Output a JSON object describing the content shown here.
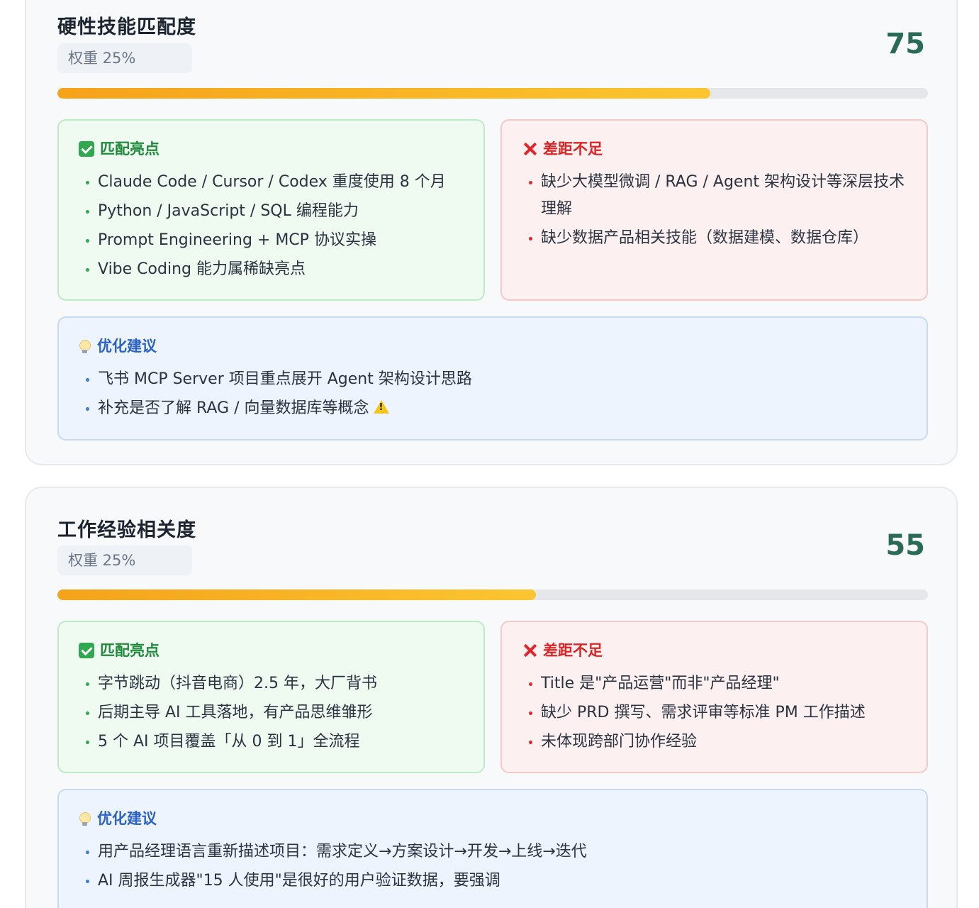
{
  "cards": [
    {
      "title": "硬性技能匹配度",
      "weight": "权重 25%",
      "score": "75",
      "progress_percent": 75,
      "good": {
        "header": "匹配亮点",
        "icon": "check-box-icon",
        "items": [
          "Claude Code / Cursor / Codex 重度使用 8 个月",
          "Python / JavaScript / SQL 编程能力",
          "Prompt Engineering + MCP 协议实操",
          "Vibe Coding 能力属稀缺亮点"
        ]
      },
      "bad": {
        "header": "差距不足",
        "icon": "cross-icon",
        "items": [
          "缺少大模型微调 / RAG / Agent 架构设计等深层技术理解",
          "缺少数据产品相关技能（数据建模、数据仓库）"
        ]
      },
      "tip": {
        "header": "优化建议",
        "icon": "lightbulb-icon",
        "items": [
          "飞书 MCP Server 项目重点展开 Agent 架构设计思路",
          "补充是否了解 RAG / 向量数据库等概念"
        ],
        "warning_icon": "warning-icon"
      }
    },
    {
      "title": "工作经验相关度",
      "weight": "权重 25%",
      "score": "55",
      "progress_percent": 55,
      "good": {
        "header": "匹配亮点",
        "icon": "check-box-icon",
        "items": [
          "字节跳动（抖音电商）2.5 年，大厂背书",
          "后期主导 AI 工具落地，有产品思维雏形",
          "5 个 AI 项目覆盖「从 0 到 1」全流程"
        ]
      },
      "bad": {
        "header": "差距不足",
        "icon": "cross-icon",
        "items": [
          "Title 是\"产品运营\"而非\"产品经理\"",
          "缺少 PRD 撰写、需求评审等标准 PM 工作描述",
          "未体现跨部门协作经验"
        ]
      },
      "tip": {
        "header": "优化建议",
        "icon": "lightbulb-icon",
        "items": [
          "用产品经理语言重新描述项目：需求定义→方案设计→开发→上线→迭代",
          "AI 周报生成器\"15 人使用\"是很好的用户验证数据，要强调"
        ]
      }
    }
  ],
  "colors": {
    "score": "#2a6b55",
    "progress_start": "#f5a31a",
    "progress_end": "#fbc531",
    "good_accent": "#1e8a3a",
    "bad_accent": "#d92525",
    "tip_accent": "#2b63c7"
  }
}
